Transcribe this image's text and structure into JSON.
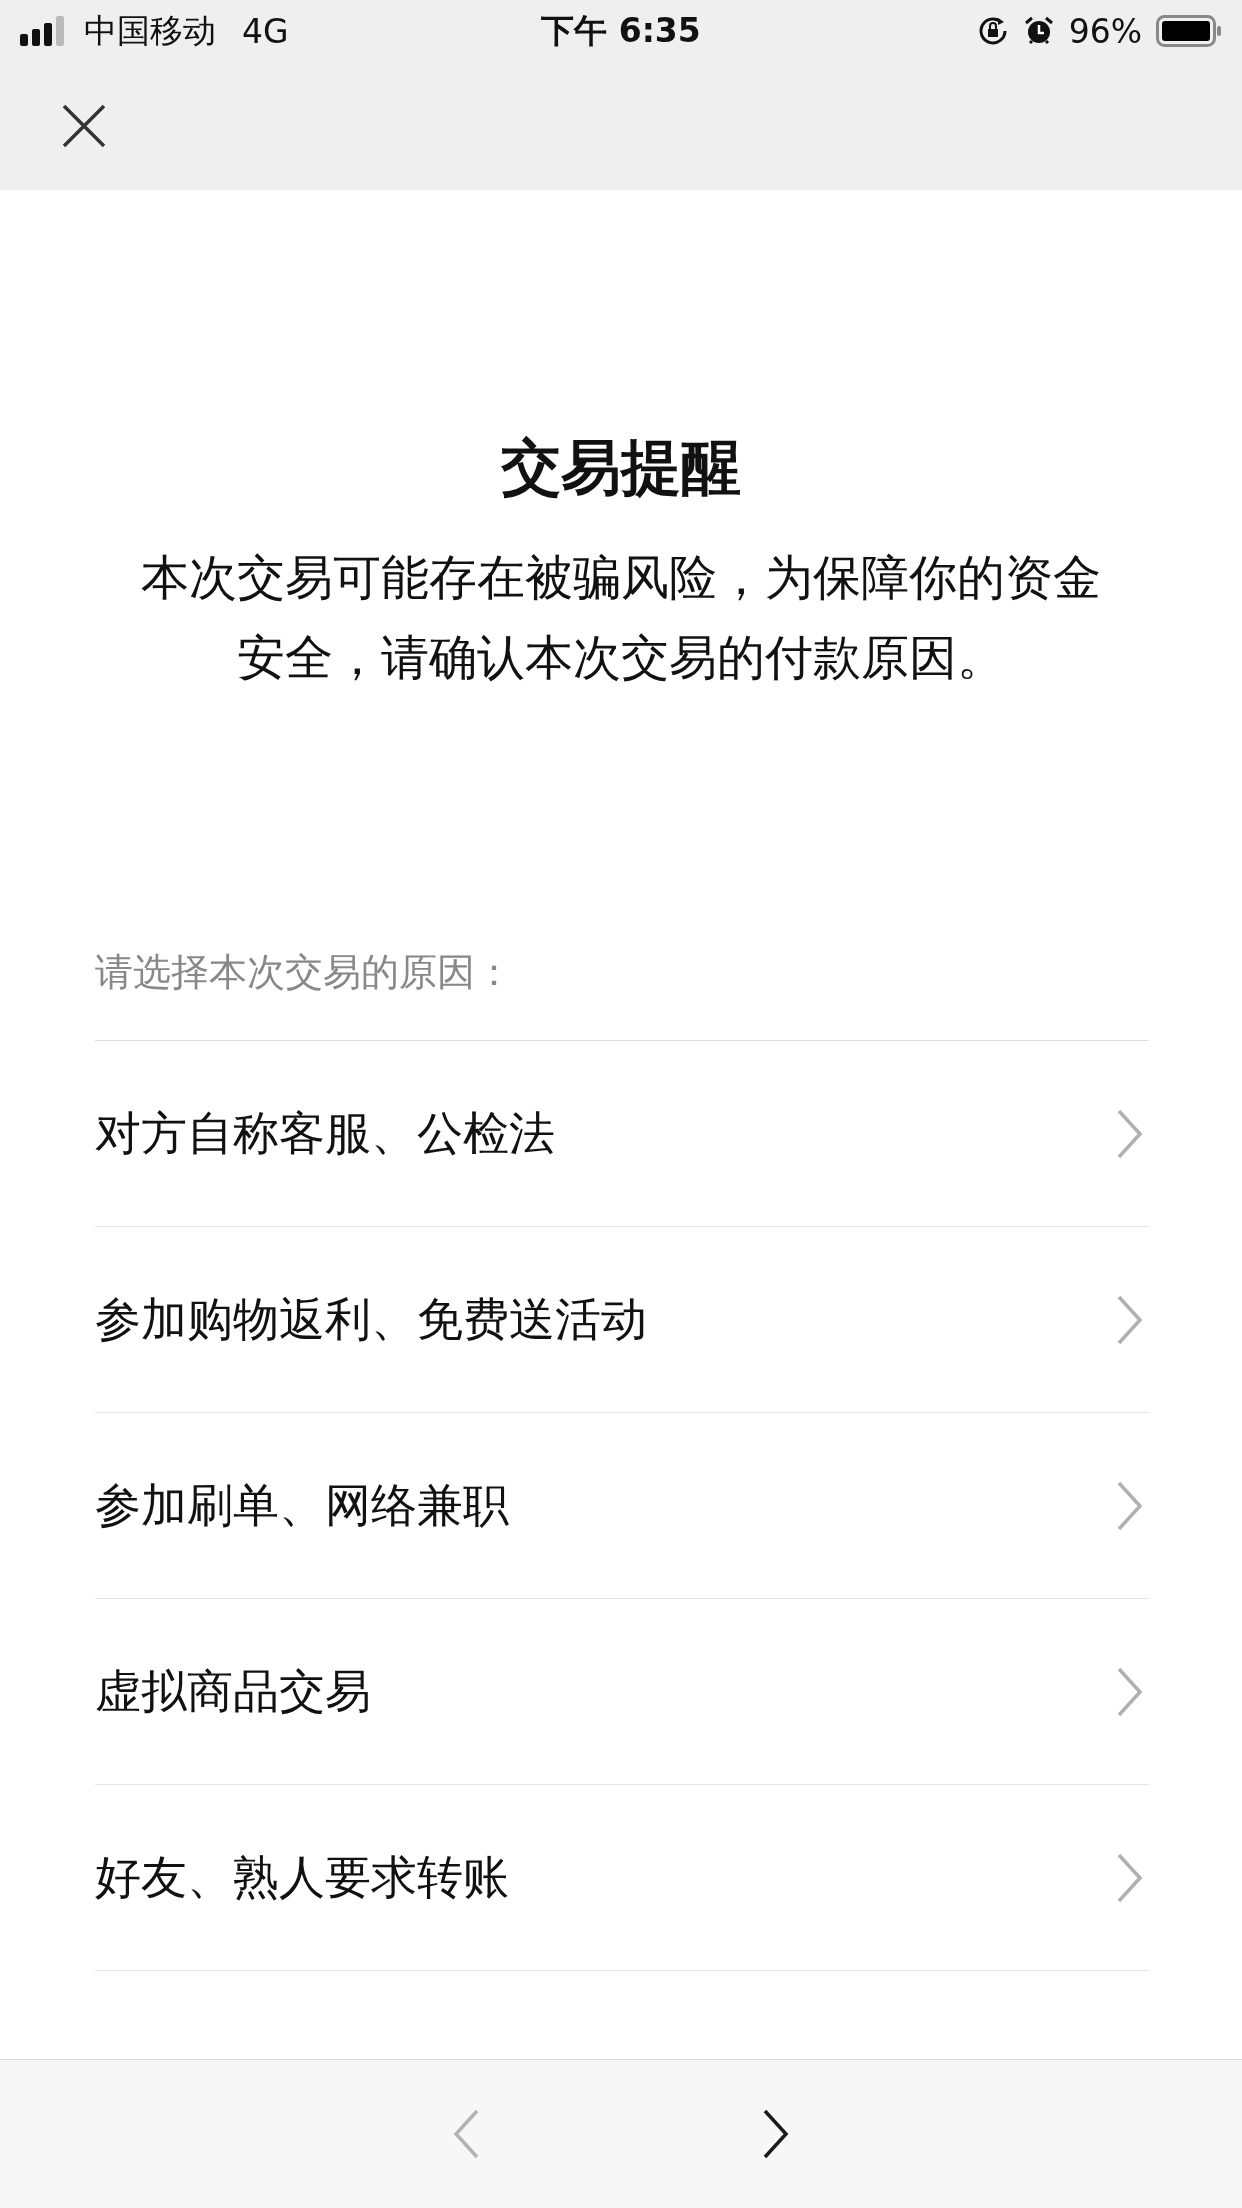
{
  "status_bar": {
    "carrier": "中国移动",
    "network": "4G",
    "time": "下午 6:35",
    "battery": "96%"
  },
  "title": "交易提醒",
  "description": "本次交易可能存在被骗风险，为保障你的资金安全，请确认本次交易的付款原因。",
  "prompt": "请选择本次交易的原因：",
  "reasons": [
    {
      "label": "对方自称客服、公检法"
    },
    {
      "label": "参加购物返利、免费送活动"
    },
    {
      "label": "参加刷单、网络兼职"
    },
    {
      "label": "虚拟商品交易"
    },
    {
      "label": "好友、熟人要求转账"
    }
  ],
  "toolbar": {
    "back": {
      "disabled": true
    },
    "forward": {
      "disabled": false
    }
  }
}
